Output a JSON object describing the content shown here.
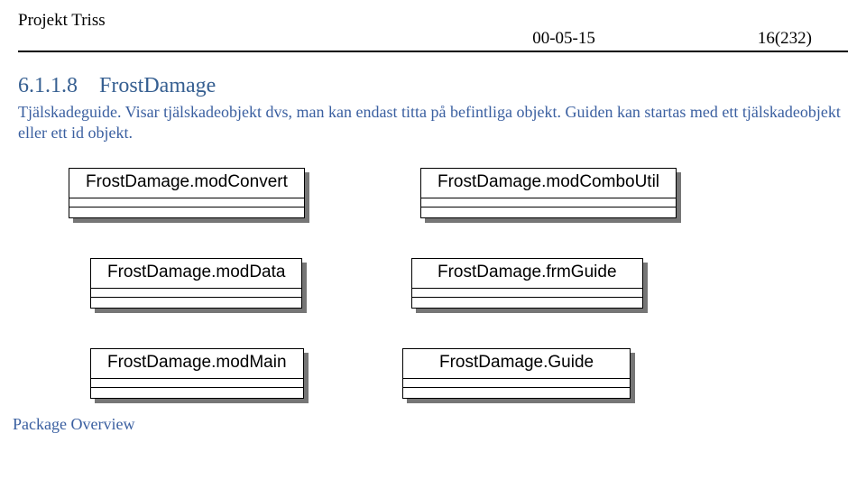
{
  "header": {
    "project": "Projekt Triss",
    "date": "00-05-15",
    "page": "16(232)"
  },
  "section": {
    "number": "6.1.1.8",
    "title": "FrostDamage",
    "desc_line1": "Tjälskadeguide.",
    "desc_rest": "Visar tjälskadeobjekt dvs, man kan endast titta på befintliga objekt. Guiden kan startas med ett tjälskadeobjekt eller ett id objekt."
  },
  "classes": {
    "r1c1": "FrostDamage.modConvert",
    "r1c2": "FrostDamage.modComboUtil",
    "r2c1": "FrostDamage.modData",
    "r2c2": "FrostDamage.frmGuide",
    "r3c1": "FrostDamage.modMain",
    "r3c2": "FrostDamage.Guide"
  },
  "footer": {
    "label": "Package Overview"
  }
}
